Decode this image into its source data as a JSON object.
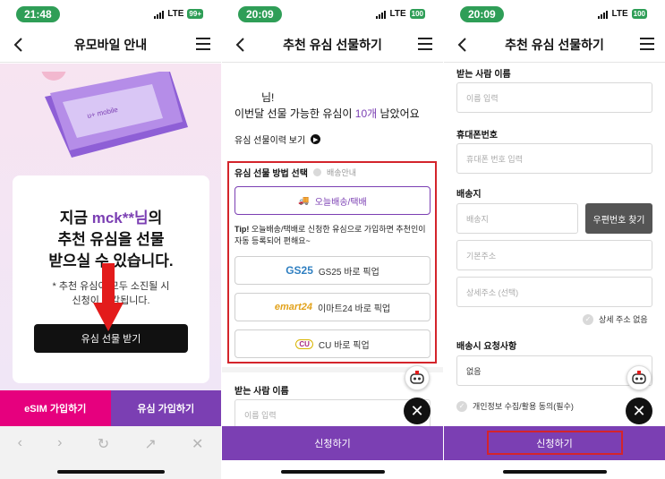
{
  "p1": {
    "time": "21:48",
    "network": "LTE",
    "battery": "99+",
    "title": "유모바일 안내",
    "headline_prefix": "지금 ",
    "headline_user": "mck**님",
    "headline_suffix": "의",
    "headline_line2": "추천 유심을 선물",
    "headline_line3": "받으실 수 있습니다.",
    "note_line1": "* 추천 유심이 모두 소진될 시",
    "note_line2": "신청이 마감됩니다.",
    "receive_button": "유심 선물 받기",
    "tab_esim": "eSIM 가입하기",
    "tab_usim": "유심 가입하기"
  },
  "p2": {
    "time": "20:09",
    "network": "LTE",
    "battery": "100",
    "title": "추천 유심 선물하기",
    "greet_name_suffix": "님!",
    "greet_prefix": "이번달 선물 가능한 유심이 ",
    "greet_count": "10개",
    "greet_suffix": " 남았어요",
    "history_link": "유심 선물이력 보기",
    "method_title": "유심 선물 방법 선택",
    "delivery_info": "배송안내",
    "opt_delivery": "오늘배송/택배",
    "tip_label": "Tip!",
    "tip_text": " 오늘배송/택배로 신청한 유심으로 가입하면 추천인이 자동 등록되어 편해요~",
    "gs25_logo": "GS25",
    "gs25_label": "GS25 바로 픽업",
    "emart_logo": "emart24",
    "emart_label": "이마트24 바로 픽업",
    "cu_logo": "CU",
    "cu_label": "CU 바로 픽업",
    "recipient_label": "받는 사람 이름",
    "recipient_placeholder": "이름 입력",
    "submit": "신청하기"
  },
  "p3": {
    "time": "20:09",
    "network": "LTE",
    "battery": "100",
    "title": "추천 유심 선물하기",
    "recipient_label": "받는 사람 이름",
    "recipient_placeholder": "이름 입력",
    "phone_label": "휴대폰번호",
    "phone_placeholder": "휴대폰 번호 입력",
    "address_label": "배송지",
    "address_placeholder": "배송지",
    "zip_button": "우편번호 찾기",
    "address_base": "기본주소",
    "address_detail": "상세주소 (선택)",
    "no_detail": "상세 주소 없음",
    "request_label": "배송시 요청사항",
    "request_value": "없음",
    "consent": "개인정보 수집/활용 동의(필수)",
    "submit": "신청하기"
  },
  "colors": {
    "brand_purple": "#7b3fb3",
    "brand_pink": "#e6007e",
    "highlight_red": "#d4242b",
    "status_green": "#2f9e57"
  }
}
